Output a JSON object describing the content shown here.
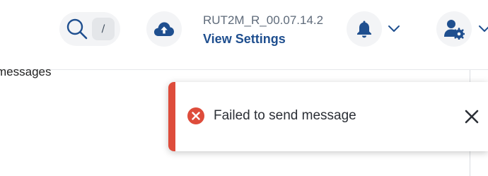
{
  "header": {
    "search": {
      "icon": "search-icon",
      "shortcut_key": "/"
    },
    "upload_icon": "cloud-upload-icon",
    "firmware": {
      "version": "RUT2M_R_00.07.14.2",
      "link_label": "View Settings"
    },
    "notifications_icon": "bell-icon",
    "user_icon": "user-settings-icon"
  },
  "content": {
    "partial_text": "messages"
  },
  "toast": {
    "message": "Failed to send message",
    "icon": "error-icon",
    "close_icon": "close-icon"
  },
  "colors": {
    "brand": "#1f4f8f",
    "error": "#de4c3b",
    "muted_text": "#5f6b7a",
    "button_background": "#f3f4f6"
  }
}
